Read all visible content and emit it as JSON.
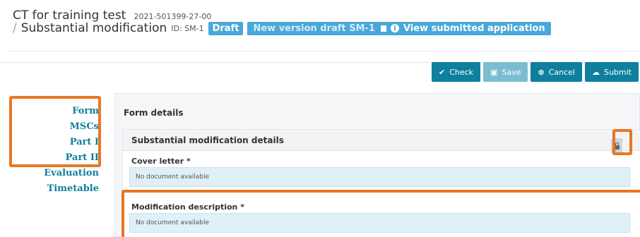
{
  "header": {
    "title": "CT for training test",
    "code": "2021-501399-27-00",
    "separator": "/",
    "subtitle": "Substantial modification",
    "id_text": "ID: SM-1",
    "status_badge": "Draft",
    "version_badge": "New version draft SM-1",
    "view_link": "View submitted application"
  },
  "toolbar": {
    "check_label": "Check",
    "save_label": "Save",
    "cancel_label": "Cancel",
    "submit_label": "Submit"
  },
  "nav": {
    "items": [
      {
        "label": "Form"
      },
      {
        "label": "MSCs"
      },
      {
        "label": "Part I"
      },
      {
        "label": "Part II"
      },
      {
        "label": "Evaluation"
      },
      {
        "label": "Timetable"
      }
    ]
  },
  "main": {
    "panel_title": "Form details",
    "section_title": "Substantial modification details",
    "fields": [
      {
        "label": "Cover letter *",
        "value": "No document available"
      },
      {
        "label": "Modification description *",
        "value": "No document available"
      }
    ]
  },
  "colors": {
    "accent": "#0f7f9e",
    "badge": "#4aa8d8",
    "highlight": "#e87722",
    "field_bg": "#dff0f7"
  },
  "icons": [
    "check-icon",
    "save-icon",
    "cancel-icon",
    "cloud-upload-icon",
    "trash-icon",
    "info-icon",
    "lock-icon"
  ]
}
